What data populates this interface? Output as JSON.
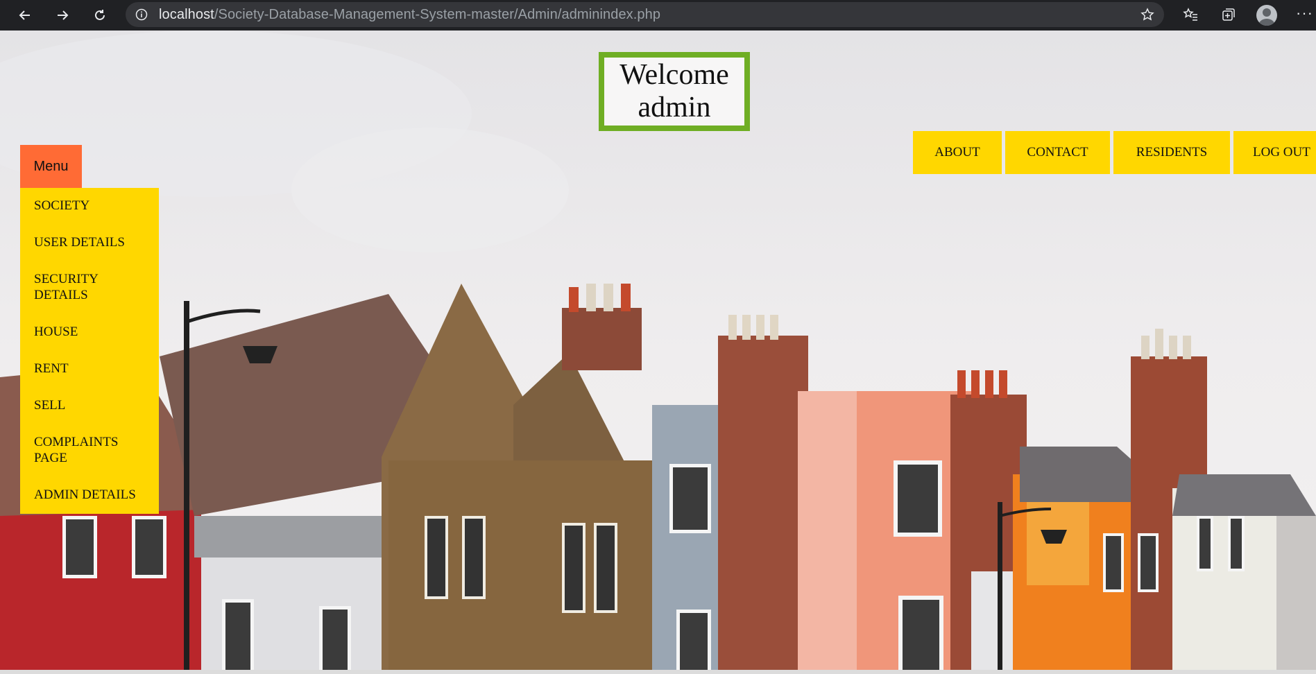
{
  "browser": {
    "url_host": "localhost",
    "url_path": "/Society-Database-Management-System-master/Admin/adminindex.php",
    "icons": [
      "back-icon",
      "forward-icon",
      "reload-icon",
      "info-icon",
      "star-icon",
      "favorites-icon",
      "collections-icon",
      "profile-icon",
      "more-icon"
    ]
  },
  "welcome": {
    "text": "Welcome admin"
  },
  "topnav": {
    "items": [
      "ABOUT",
      "CONTACT",
      "RESIDENTS",
      "LOG OUT"
    ]
  },
  "menu": {
    "button_label": "Menu",
    "items": [
      "SOCIETY",
      "USER DETAILS",
      "SECURITY DETAILS",
      "HOUSE",
      "RENT",
      "SELL",
      "COMPLAINTS PAGE",
      "ADMIN DETAILS"
    ]
  },
  "colors": {
    "chrome_bg": "#202124",
    "nav_yellow": "#ffd700",
    "menu_orange": "#ff6b35",
    "welcome_border": "#6fae24"
  }
}
